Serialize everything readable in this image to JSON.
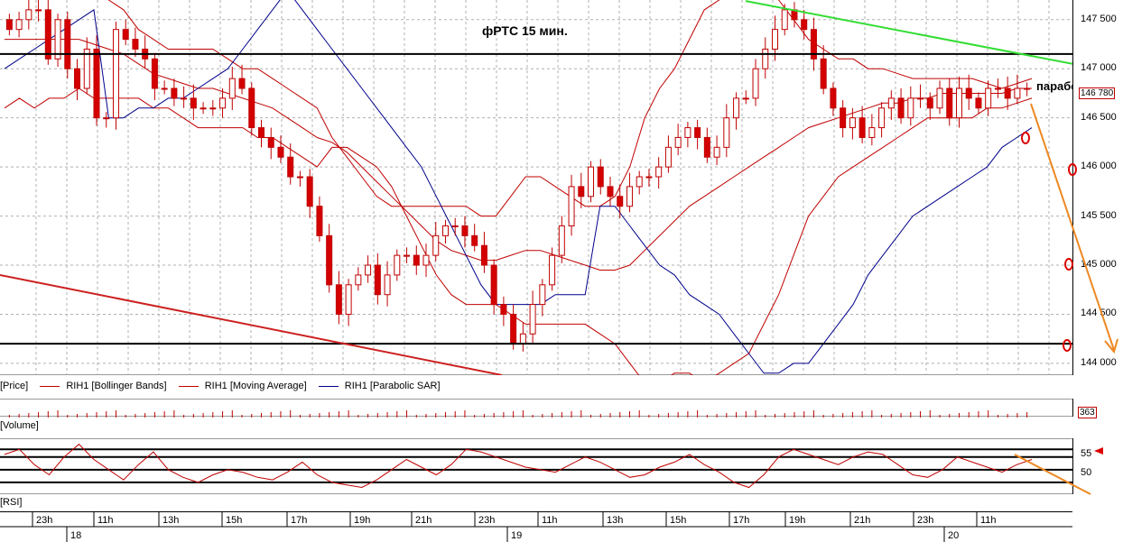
{
  "chart_data": {
    "type": "candlestick",
    "title": "фРТС   15 мин.",
    "annotation": "параболик",
    "price_axis": {
      "ticks": [
        "147 500",
        "147 000",
        "146 500",
        "146 000",
        "145 500",
        "145 000",
        "144 500",
        "144 000"
      ],
      "ylim": [
        143880,
        147700
      ],
      "last_price": "146 780"
    },
    "volume_value": "363",
    "rsi_axis": {
      "ticks": [
        "55",
        "50"
      ]
    },
    "time_labels": [
      "23h",
      "11h",
      "13h",
      "15h",
      "17h",
      "19h",
      "21h",
      "23h",
      "11h",
      "13h",
      "15h",
      "17h",
      "19h",
      "21h",
      "23h",
      "11h"
    ],
    "date_labels": [
      "18",
      "19",
      "20"
    ],
    "pane_labels": {
      "price": "[Price]",
      "volume": "[Volume]",
      "rsi": "[RSI]"
    },
    "legend": [
      {
        "name": "RIH1 [Bollinger Bands]",
        "color": "#c00000"
      },
      {
        "name": "RIH1 [Moving Average]",
        "color": "#c00000"
      },
      {
        "name": "RIH1 [Parabolic SAR]",
        "color": "#00008b"
      }
    ],
    "closes": [
      147400,
      147500,
      147600,
      147600,
      147100,
      147500,
      147000,
      146800,
      147200,
      146500,
      146500,
      147400,
      147300,
      147200,
      147100,
      146800,
      146800,
      146700,
      146700,
      146600,
      146600,
      146600,
      146700,
      146900,
      146800,
      146400,
      146300,
      146200,
      146100,
      145900,
      145900,
      145600,
      145300,
      144800,
      144500,
      144800,
      144900,
      145000,
      144700,
      144900,
      145100,
      145100,
      145000,
      145100,
      145300,
      145400,
      145400,
      145300,
      145200,
      145000,
      144600,
      144500,
      144200,
      144300,
      144600,
      144800,
      145100,
      145400,
      145800,
      145700,
      146000,
      145800,
      145700,
      145600,
      145800,
      145900,
      145900,
      146000,
      146200,
      146300,
      146400,
      146300,
      146100,
      146200,
      146500,
      146700,
      146700,
      147000,
      147200,
      147400,
      147600,
      147500,
      147400,
      147100,
      146800,
      146600,
      146400,
      146500,
      146300,
      146400,
      146600,
      146700,
      146500,
      146700,
      146700,
      146600,
      146800,
      146500,
      146800,
      146700,
      146600,
      146800,
      146800,
      146700,
      146800,
      146800
    ],
    "bb_mid": [
      147300,
      147300,
      147300,
      147300,
      147300,
      147300,
      147250,
      147200,
      147150,
      147050,
      146950,
      146900,
      146850,
      146800,
      146800,
      146750,
      146700,
      146650,
      146600,
      146500,
      146400,
      146300,
      146250,
      146150,
      146000,
      145850,
      145700,
      145550,
      145400,
      145250,
      145150,
      145100,
      145050,
      145050,
      145100,
      145150,
      145150,
      145100,
      145050,
      145000,
      144950,
      144950,
      145000,
      145150,
      145300,
      145450,
      145600,
      145700,
      145800,
      145900,
      146000,
      146100,
      146200,
      146300,
      146400,
      146450,
      146500,
      146550,
      146600,
      146650,
      146650,
      146700,
      146700,
      146750,
      146750,
      146750,
      146750,
      146750,
      146800,
      146800
    ],
    "bb_up": [
      148000,
      148000,
      148000,
      147900,
      147900,
      147800,
      147800,
      147700,
      147600,
      147400,
      147300,
      147200,
      147200,
      147200,
      147200,
      147100,
      147000,
      147000,
      146900,
      146800,
      146700,
      146600,
      146300,
      146100,
      145900,
      145700,
      145600,
      145600,
      145600,
      145600,
      145600,
      145600,
      145500,
      145500,
      145700,
      145900,
      145900,
      145800,
      145700,
      145600,
      145600,
      145700,
      146000,
      146500,
      146800,
      147000,
      147300,
      147600,
      147700,
      147800,
      147900,
      147800,
      147700,
      147500,
      147300,
      147200,
      147100,
      147100,
      147000,
      147000,
      146950,
      146900,
      146900,
      146900,
      146900,
      146900,
      146850,
      146800,
      146850,
      146900
    ],
    "bb_lo": [
      146600,
      146700,
      146600,
      146700,
      146700,
      146800,
      146700,
      146700,
      146700,
      146700,
      146600,
      146600,
      146500,
      146400,
      146400,
      146400,
      146400,
      146300,
      146300,
      146200,
      146100,
      146000,
      146200,
      146200,
      146100,
      146000,
      145800,
      145500,
      145200,
      144900,
      144700,
      144600,
      144600,
      144600,
      144500,
      144400,
      144400,
      144400,
      144400,
      144400,
      144300,
      144200,
      144000,
      143800,
      143800,
      143900,
      143900,
      143800,
      143900,
      144000,
      144100,
      144400,
      144700,
      145100,
      145500,
      145700,
      145900,
      146000,
      146100,
      146200,
      146300,
      146400,
      146500,
      146500,
      146500,
      146500,
      146600,
      146600,
      146650,
      146700
    ],
    "sar": [
      147000,
      147100,
      147200,
      147300,
      147400,
      147500,
      147600,
      146500,
      146500,
      146600,
      146600,
      146700,
      146700,
      146800,
      146900,
      147000,
      147200,
      147400,
      147600,
      147800,
      147600,
      147400,
      147200,
      147000,
      146800,
      146600,
      146400,
      146200,
      146000,
      145700,
      145400,
      145100,
      144800,
      144600,
      144600,
      144600,
      144600,
      144700,
      144700,
      144700,
      145600,
      145600,
      145400,
      145200,
      145000,
      144900,
      144700,
      144600,
      144500,
      144300,
      144100,
      143900,
      143900,
      144000,
      144000,
      144200,
      144400,
      144600,
      144900,
      145100,
      145300,
      145500,
      145600,
      145700,
      145800,
      145900,
      146000,
      146200,
      146300,
      146400
    ],
    "rsi": [
      56,
      58,
      52,
      48,
      55,
      60,
      54,
      50,
      46,
      52,
      57,
      50,
      47,
      45,
      48,
      50,
      49,
      47,
      46,
      49,
      53,
      48,
      45,
      44,
      43,
      46,
      50,
      54,
      51,
      48,
      52,
      58,
      57,
      55,
      53,
      51,
      50,
      49,
      52,
      55,
      53,
      50,
      47,
      48,
      51,
      53,
      56,
      52,
      49,
      45,
      43,
      48,
      55,
      58,
      56,
      54,
      52,
      55,
      57,
      56,
      52,
      48,
      47,
      50,
      55,
      53,
      51,
      49,
      52,
      54
    ],
    "levels": {
      "resistance": 147150,
      "support": 144200
    }
  }
}
